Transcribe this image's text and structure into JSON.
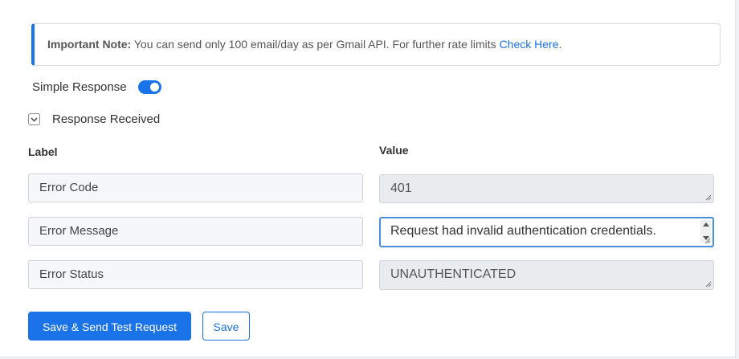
{
  "note": {
    "prefix": "Important Note:",
    "text": " You can send only 100 email/day as per Gmail API. For further rate limits ",
    "link": "Check Here",
    "suffix": "."
  },
  "simple_response": {
    "label": "Simple Response",
    "enabled": true
  },
  "response_received": {
    "label": "Response Received",
    "icon": "chevron-down-icon"
  },
  "columns": {
    "label": "Label",
    "value": "Value"
  },
  "rows": [
    {
      "label": "Error Code",
      "value": "401"
    },
    {
      "label": "Error Message",
      "value": "Request had invalid authentication credentials."
    },
    {
      "label": "Error Status",
      "value": "UNAUTHENTICATED"
    }
  ],
  "buttons": {
    "save_send": "Save & Send Test Request",
    "save": "Save"
  },
  "colors": {
    "accent": "#1a73e8"
  }
}
